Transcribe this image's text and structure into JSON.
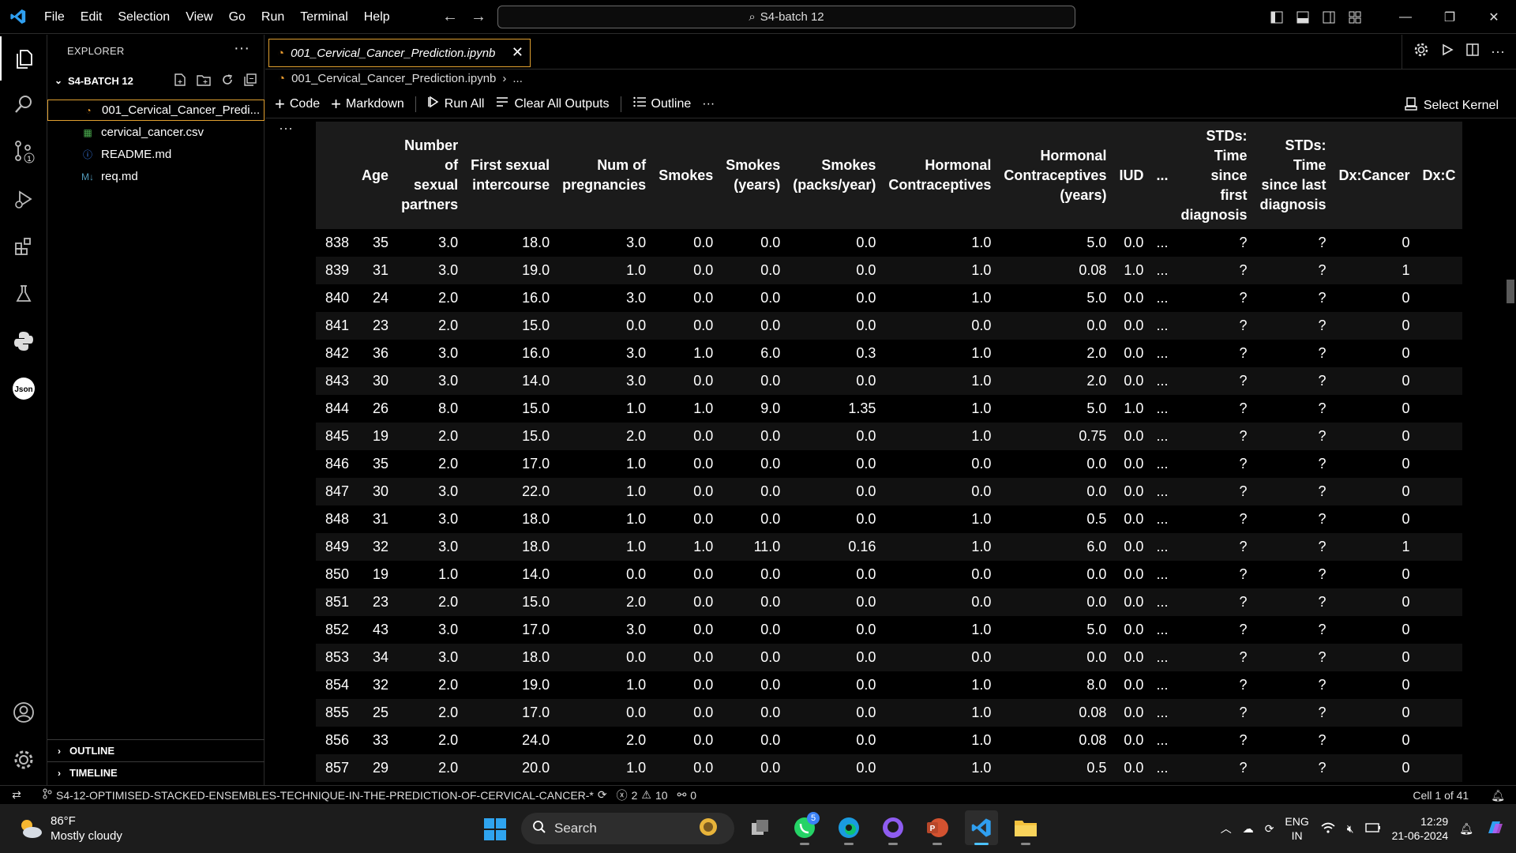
{
  "menu": [
    "File",
    "Edit",
    "Selection",
    "View",
    "Go",
    "Run",
    "Terminal",
    "Help"
  ],
  "command_center": "S4-batch 12",
  "explorer": {
    "title": "EXPLORER",
    "folder": "S4-BATCH 12",
    "files": [
      {
        "name": "001_Cervical_Cancer_Predi...",
        "icon": "notebook-icon",
        "color": "#f0a030"
      },
      {
        "name": "cervical_cancer.csv",
        "icon": "csv-icon",
        "color": "#4caf50"
      },
      {
        "name": "README.md",
        "icon": "info-icon",
        "color": "#3b82f6"
      },
      {
        "name": "req.md",
        "icon": "markdown-icon",
        "color": "#519aba"
      }
    ],
    "sections": [
      "OUTLINE",
      "TIMELINE"
    ]
  },
  "tab": {
    "label": "001_Cervical_Cancer_Prediction.ipynb"
  },
  "breadcrumb": {
    "file": "001_Cervical_Cancer_Prediction.ipynb",
    "rest": "..."
  },
  "toolbar": {
    "code": "Code",
    "markdown": "Markdown",
    "run_all": "Run All",
    "clear": "Clear All Outputs",
    "outline": "Outline",
    "more": "···",
    "kernel": "Select Kernel"
  },
  "table": {
    "columns": [
      [
        "Age"
      ],
      [
        "Number",
        "of",
        "sexual",
        "partners"
      ],
      [
        "First sexual",
        "intercourse"
      ],
      [
        "Num of",
        "pregnancies"
      ],
      [
        "Smokes"
      ],
      [
        "Smokes",
        "(years)"
      ],
      [
        "Smokes",
        "(packs/year)"
      ],
      [
        "Hormonal",
        "Contraceptives"
      ],
      [
        "Hormonal",
        "Contraceptives",
        "(years)"
      ],
      [
        "IUD"
      ],
      [
        "..."
      ],
      [
        "STDs:",
        "Time",
        "since",
        "first",
        "diagnosis"
      ],
      [
        "STDs:",
        "Time",
        "since last",
        "diagnosis"
      ],
      [
        "Dx:Cancer"
      ],
      [
        "Dx:C"
      ]
    ],
    "rows": [
      [
        "838",
        "35",
        "3.0",
        "18.0",
        "3.0",
        "0.0",
        "0.0",
        "0.0",
        "1.0",
        "5.0",
        "0.0",
        "...",
        "?",
        "?",
        "0",
        ""
      ],
      [
        "839",
        "31",
        "3.0",
        "19.0",
        "1.0",
        "0.0",
        "0.0",
        "0.0",
        "1.0",
        "0.08",
        "1.0",
        "...",
        "?",
        "?",
        "1",
        ""
      ],
      [
        "840",
        "24",
        "2.0",
        "16.0",
        "3.0",
        "0.0",
        "0.0",
        "0.0",
        "1.0",
        "5.0",
        "0.0",
        "...",
        "?",
        "?",
        "0",
        ""
      ],
      [
        "841",
        "23",
        "2.0",
        "15.0",
        "0.0",
        "0.0",
        "0.0",
        "0.0",
        "0.0",
        "0.0",
        "0.0",
        "...",
        "?",
        "?",
        "0",
        ""
      ],
      [
        "842",
        "36",
        "3.0",
        "16.0",
        "3.0",
        "1.0",
        "6.0",
        "0.3",
        "1.0",
        "2.0",
        "0.0",
        "...",
        "?",
        "?",
        "0",
        ""
      ],
      [
        "843",
        "30",
        "3.0",
        "14.0",
        "3.0",
        "0.0",
        "0.0",
        "0.0",
        "1.0",
        "2.0",
        "0.0",
        "...",
        "?",
        "?",
        "0",
        ""
      ],
      [
        "844",
        "26",
        "8.0",
        "15.0",
        "1.0",
        "1.0",
        "9.0",
        "1.35",
        "1.0",
        "5.0",
        "1.0",
        "...",
        "?",
        "?",
        "0",
        ""
      ],
      [
        "845",
        "19",
        "2.0",
        "15.0",
        "2.0",
        "0.0",
        "0.0",
        "0.0",
        "1.0",
        "0.75",
        "0.0",
        "...",
        "?",
        "?",
        "0",
        ""
      ],
      [
        "846",
        "35",
        "2.0",
        "17.0",
        "1.0",
        "0.0",
        "0.0",
        "0.0",
        "0.0",
        "0.0",
        "0.0",
        "...",
        "?",
        "?",
        "0",
        ""
      ],
      [
        "847",
        "30",
        "3.0",
        "22.0",
        "1.0",
        "0.0",
        "0.0",
        "0.0",
        "0.0",
        "0.0",
        "0.0",
        "...",
        "?",
        "?",
        "0",
        ""
      ],
      [
        "848",
        "31",
        "3.0",
        "18.0",
        "1.0",
        "0.0",
        "0.0",
        "0.0",
        "1.0",
        "0.5",
        "0.0",
        "...",
        "?",
        "?",
        "0",
        ""
      ],
      [
        "849",
        "32",
        "3.0",
        "18.0",
        "1.0",
        "1.0",
        "11.0",
        "0.16",
        "1.0",
        "6.0",
        "0.0",
        "...",
        "?",
        "?",
        "1",
        ""
      ],
      [
        "850",
        "19",
        "1.0",
        "14.0",
        "0.0",
        "0.0",
        "0.0",
        "0.0",
        "0.0",
        "0.0",
        "0.0",
        "...",
        "?",
        "?",
        "0",
        ""
      ],
      [
        "851",
        "23",
        "2.0",
        "15.0",
        "2.0",
        "0.0",
        "0.0",
        "0.0",
        "0.0",
        "0.0",
        "0.0",
        "...",
        "?",
        "?",
        "0",
        ""
      ],
      [
        "852",
        "43",
        "3.0",
        "17.0",
        "3.0",
        "0.0",
        "0.0",
        "0.0",
        "1.0",
        "5.0",
        "0.0",
        "...",
        "?",
        "?",
        "0",
        ""
      ],
      [
        "853",
        "34",
        "3.0",
        "18.0",
        "0.0",
        "0.0",
        "0.0",
        "0.0",
        "0.0",
        "0.0",
        "0.0",
        "...",
        "?",
        "?",
        "0",
        ""
      ],
      [
        "854",
        "32",
        "2.0",
        "19.0",
        "1.0",
        "0.0",
        "0.0",
        "0.0",
        "1.0",
        "8.0",
        "0.0",
        "...",
        "?",
        "?",
        "0",
        ""
      ],
      [
        "855",
        "25",
        "2.0",
        "17.0",
        "0.0",
        "0.0",
        "0.0",
        "0.0",
        "1.0",
        "0.08",
        "0.0",
        "...",
        "?",
        "?",
        "0",
        ""
      ],
      [
        "856",
        "33",
        "2.0",
        "24.0",
        "2.0",
        "0.0",
        "0.0",
        "0.0",
        "1.0",
        "0.08",
        "0.0",
        "...",
        "?",
        "?",
        "0",
        ""
      ],
      [
        "857",
        "29",
        "2.0",
        "20.0",
        "1.0",
        "0.0",
        "0.0",
        "0.0",
        "1.0",
        "0.5",
        "0.0",
        "...",
        "?",
        "?",
        "0",
        ""
      ]
    ]
  },
  "status": {
    "branch": "S4-12-OPTIMISED-STACKED-ENSEMBLES-TECHNIQUE-IN-THE-PREDICTION-OF-CERVICAL-CANCER-*",
    "errors": "2",
    "warnings": "10",
    "ports": "0",
    "cell": "Cell 1 of 41"
  },
  "taskbar": {
    "temp": "86°F",
    "condition": "Mostly cloudy",
    "search": "Search",
    "whatsapp_badge": "5",
    "lang1": "ENG",
    "lang2": "IN",
    "time": "12:29",
    "date": "21-06-2024"
  }
}
